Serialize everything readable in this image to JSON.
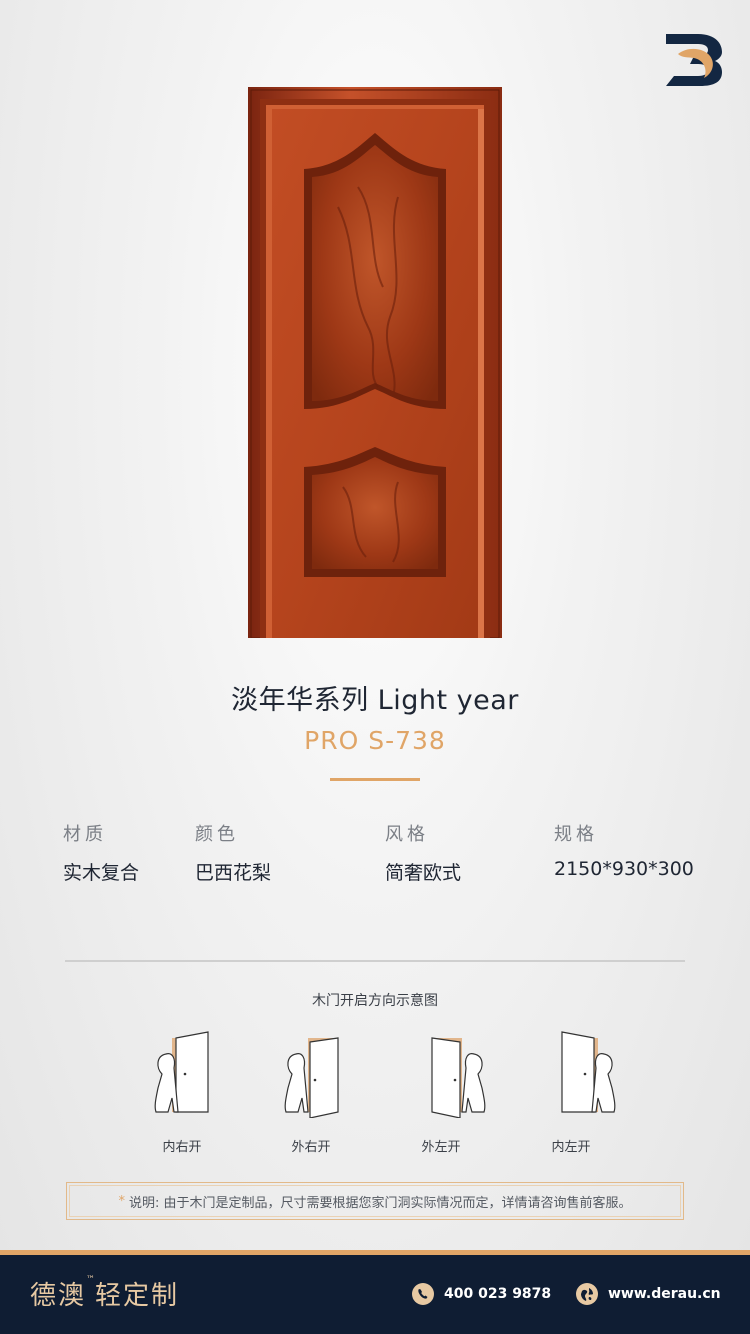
{
  "brand": {
    "logo_icon": "derau-logo-icon",
    "name": "德澳",
    "tm": "™",
    "tagline": "轻定制"
  },
  "product": {
    "series": "淡年华系列  Light year",
    "model": "PRO S-738"
  },
  "specs": [
    {
      "label": "材质",
      "value": "实木复合"
    },
    {
      "label": "颜色",
      "value": "巴西花梨"
    },
    {
      "label": "风格",
      "value": "简奢欧式"
    },
    {
      "label": "规格",
      "value": "2150*930*300"
    }
  ],
  "opening": {
    "heading": "木门开启方向示意图",
    "types": [
      {
        "label": "内右开",
        "icon": "door-inward-right-icon"
      },
      {
        "label": "外右开",
        "icon": "door-outward-right-icon"
      },
      {
        "label": "外左开",
        "icon": "door-outward-left-icon"
      },
      {
        "label": "内左开",
        "icon": "door-inward-left-icon"
      }
    ]
  },
  "note": {
    "star": "*",
    "text": "说明: 由于木门是定制品，尺寸需要根据您家门洞实际情况而定，详情请咨询售前客服。"
  },
  "footer": {
    "phone": "400 023 9878",
    "website": "www.derau.cn",
    "phone_icon": "phone-icon",
    "web_icon": "globe-icon"
  },
  "colors": {
    "accent": "#e0a567",
    "navy": "#0f1d33",
    "door": "#b8431f"
  }
}
